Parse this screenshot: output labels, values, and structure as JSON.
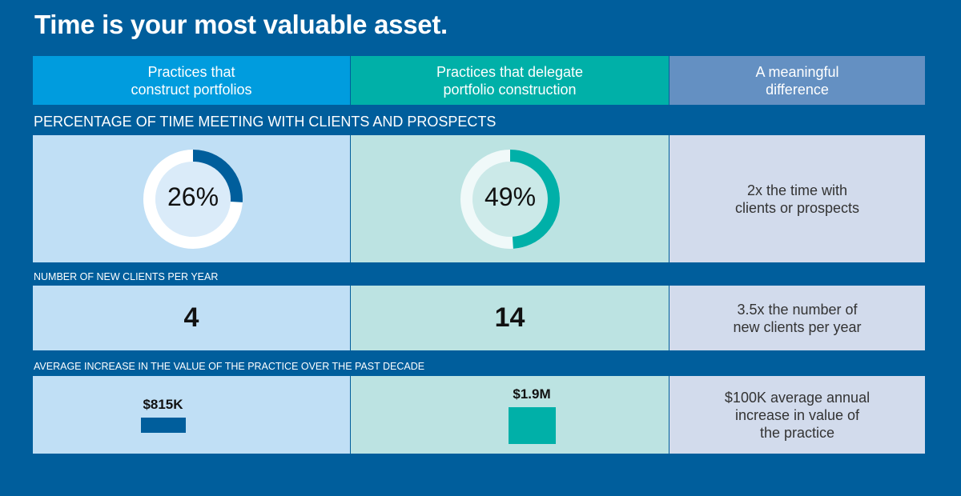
{
  "title": "Time is your most valuable asset.",
  "columns": [
    {
      "label": "Practices that\nconstruct portfolios",
      "color": "#009cde"
    },
    {
      "label": "Practices that delegate\nportfolio construction",
      "color": "#00b0a8"
    },
    {
      "label": "A meaningful\ndifference",
      "color": "#6490c2"
    }
  ],
  "sections": {
    "time": {
      "heading": "PERCENTAGE OF TIME MEETING WITH CLIENTS AND PROSPECTS",
      "construct_label": "26%",
      "delegate_label": "49%",
      "difference": "2x the time with\nclients or prospects"
    },
    "clients": {
      "heading": "NUMBER OF NEW CLIENTS PER YEAR",
      "construct_value": "4",
      "delegate_value": "14",
      "difference": "3.5x the number of\nnew clients per year"
    },
    "value": {
      "heading": "AVERAGE INCREASE IN THE VALUE OF THE PRACTICE OVER THE PAST DECADE",
      "construct_label": "$815K",
      "delegate_label": "$1.9M",
      "difference": "$100K average annual\nincrease in value of\nthe practice"
    }
  },
  "chart_data": [
    {
      "type": "pie",
      "title": "Percentage of time meeting with clients and prospects",
      "categories": [
        "Practices that construct portfolios",
        "Practices that delegate portfolio construction"
      ],
      "values": [
        26,
        49
      ],
      "unit": "%",
      "colors": [
        "#005e9c",
        "#00b0a8"
      ]
    },
    {
      "type": "table",
      "title": "Number of new clients per year",
      "categories": [
        "Practices that construct portfolios",
        "Practices that delegate portfolio construction"
      ],
      "values": [
        4,
        14
      ]
    },
    {
      "type": "bar",
      "title": "Average increase in the value of the practice over the past decade",
      "categories": [
        "Practices that construct portfolios",
        "Practices that delegate portfolio construction"
      ],
      "values": [
        815000,
        1900000
      ],
      "labels": [
        "$815K",
        "$1.9M"
      ],
      "colors": [
        "#005e9c",
        "#00b0a8"
      ]
    }
  ]
}
